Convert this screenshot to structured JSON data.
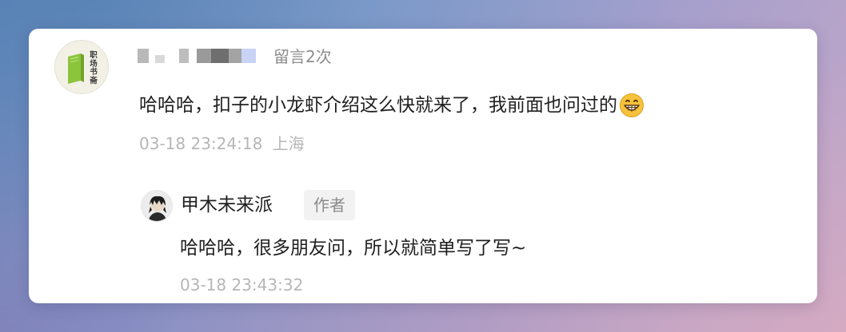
{
  "comment": {
    "avatar_logo_text": "职场书斋",
    "username_redacted": true,
    "comment_count_label": "留言2次",
    "text": "哈哈哈，扣子的小龙虾介绍这么快就来了，我前面也问过的",
    "emoji": "grinning-face-icon",
    "timestamp": "03-18 23:24:18",
    "location": "上海"
  },
  "reply": {
    "author_name": "甲木未来派",
    "author_badge": "作者",
    "text": "哈哈哈，很多朋友问，所以就简单写了写~",
    "timestamp": "03-18 23:43:32"
  },
  "colors": {
    "card_background": "#ffffff",
    "primary_text": "#1f1f1f",
    "secondary_text": "#8d8d8d",
    "meta_text": "#b6b6b6",
    "badge_background": "#f2f2f2",
    "logo_book_green": "#8cc43c"
  }
}
